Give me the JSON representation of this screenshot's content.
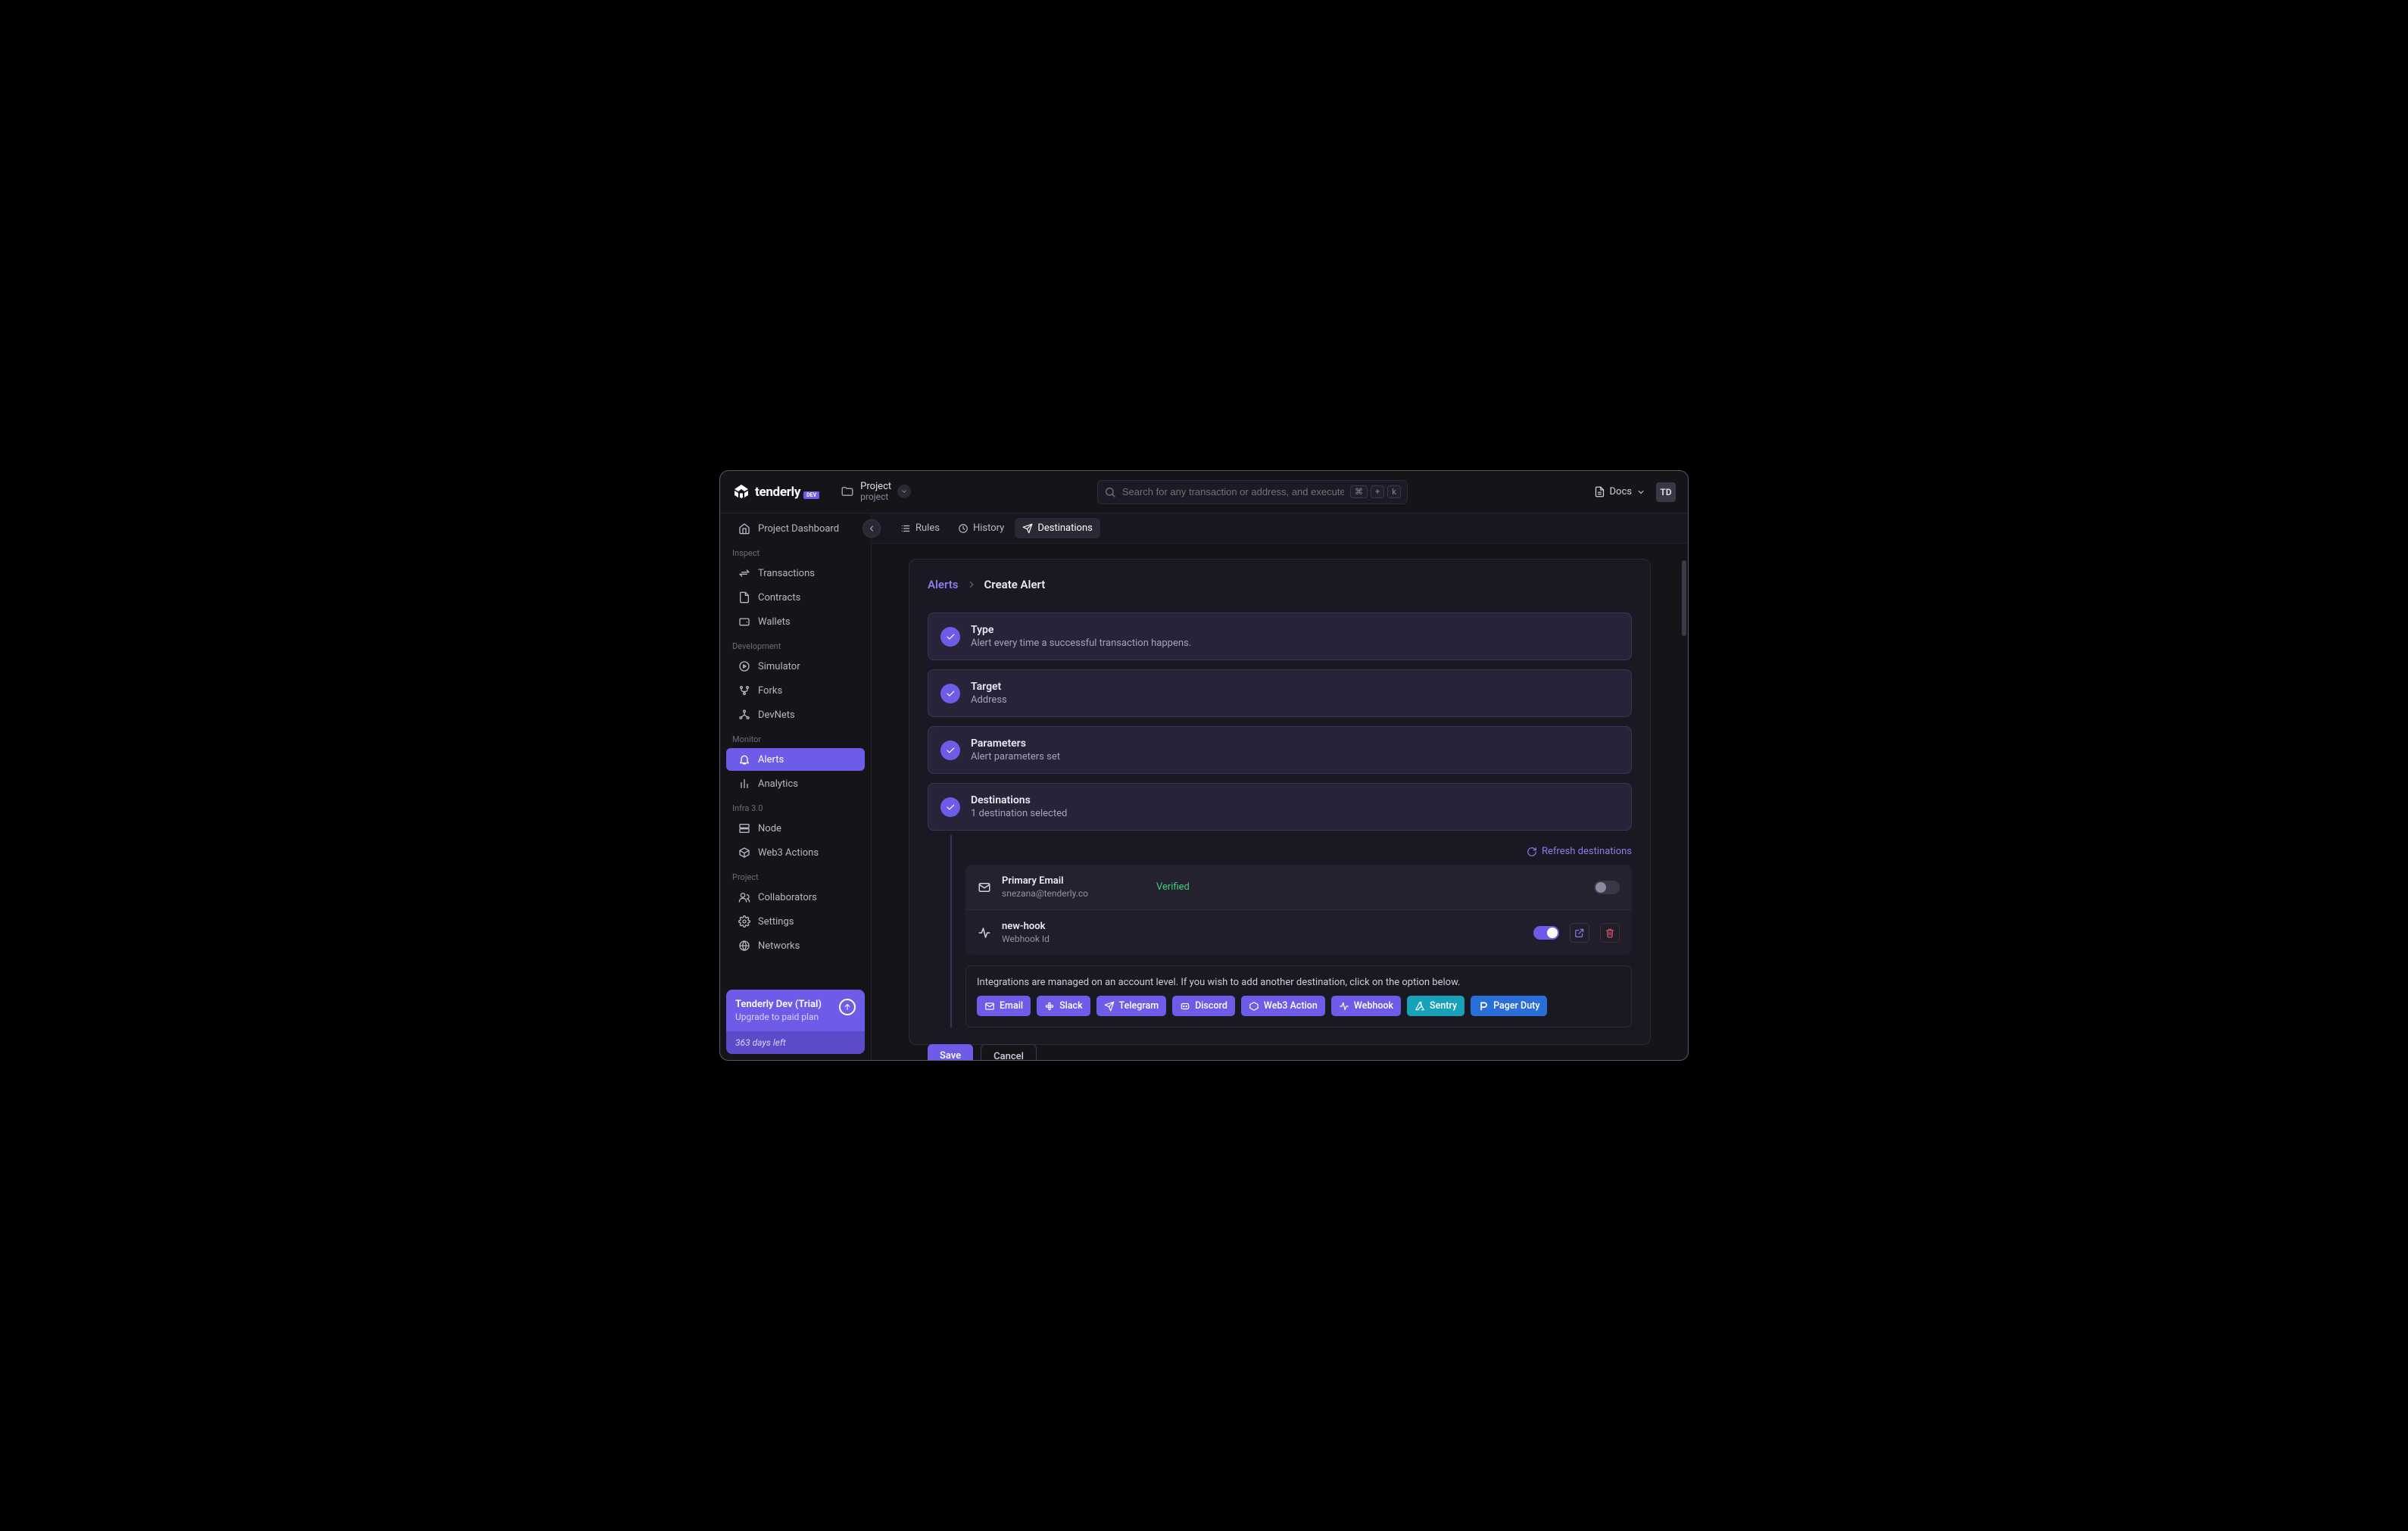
{
  "header": {
    "brand": "tenderly",
    "brand_badge": "DEV",
    "project_label": "Project",
    "project_name": "project",
    "search_placeholder": "Search for any transaction or address, and execute qui...",
    "kbd1": "⌘",
    "kbd2": "+",
    "kbd3": "k",
    "docs": "Docs",
    "avatar": "TD"
  },
  "sidebar": {
    "dashboard": "Project Dashboard",
    "groups": {
      "inspect": "Inspect",
      "development": "Development",
      "monitor": "Monitor",
      "infra": "Infra 3.0",
      "project": "Project"
    },
    "items": {
      "transactions": "Transactions",
      "contracts": "Contracts",
      "wallets": "Wallets",
      "simulator": "Simulator",
      "forks": "Forks",
      "devnets": "DevNets",
      "alerts": "Alerts",
      "analytics": "Analytics",
      "node": "Node",
      "web3actions": "Web3 Actions",
      "collaborators": "Collaborators",
      "settings": "Settings",
      "networks": "Networks"
    },
    "upgrade": {
      "title": "Tenderly Dev (Trial)",
      "sub": "Upgrade to paid plan",
      "days": "363 days left"
    }
  },
  "tabs": {
    "rules": "Rules",
    "history": "History",
    "destinations": "Destinations"
  },
  "breadcrumb": {
    "root": "Alerts",
    "current": "Create Alert"
  },
  "steps": {
    "type": {
      "title": "Type",
      "sub": "Alert every time a successful transaction happens."
    },
    "target": {
      "title": "Target",
      "sub": "Address"
    },
    "params": {
      "title": "Parameters",
      "sub": "Alert parameters set"
    },
    "dest": {
      "title": "Destinations",
      "sub": "1 destination selected"
    }
  },
  "dest_panel": {
    "refresh": "Refresh destinations",
    "rows": [
      {
        "name": "Primary Email",
        "sub": "snezana@tenderly.co",
        "status": "Verified",
        "enabled": false,
        "editable": false
      },
      {
        "name": "new-hook",
        "sub": "Webhook Id",
        "status": "",
        "enabled": true,
        "editable": true
      }
    ],
    "integ_msg": "Integrations are managed on an account level. If you wish to add another destination, click on the option below.",
    "integ": {
      "email": "Email",
      "slack": "Slack",
      "telegram": "Telegram",
      "discord": "Discord",
      "web3": "Web3 Action",
      "webhook": "Webhook",
      "sentry": "Sentry",
      "pagerduty": "Pager Duty"
    }
  },
  "actions": {
    "save": "Save",
    "cancel": "Cancel"
  }
}
